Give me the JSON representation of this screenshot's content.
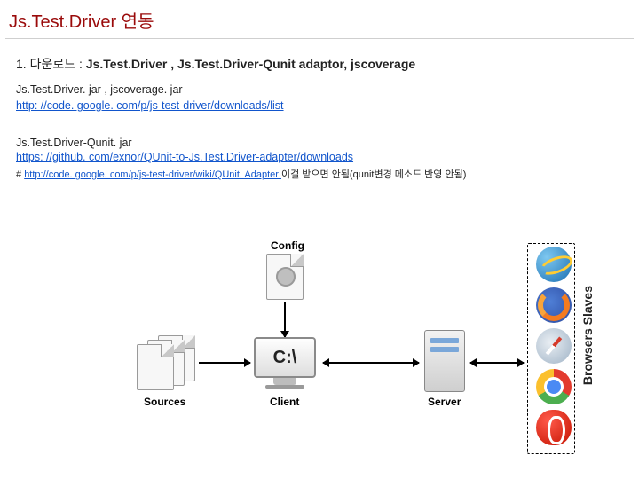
{
  "title": "Js.Test.Driver 연동",
  "step1": {
    "prefix": "1.  다운로드 : ",
    "bold": "Js.Test.Driver ,  Js.Test.Driver-Qunit adaptor,   jscoverage"
  },
  "filesLine": "Js.Test.Driver. jar , jscoverage. jar",
  "link1": "http: //code. google. com/p/js-test-driver/downloads/list",
  "jar2": "Js.Test.Driver-Qunit. jar",
  "link2": " https: //github. com/exnor/QUnit-to-Js.Test.Driver-adapter/downloads ",
  "noteHash": "# ",
  "noteLink": " http://code. google. com/p/js-test-driver/wiki/QUnit. Adapter ",
  "noteTail": " 이걸 받으면 안됨(qunit변경 메소드 반영 안됨)",
  "diagram": {
    "config": "Config",
    "sources": "Sources",
    "client": "Client",
    "server": "Server",
    "browsers": "Browsers Slaves",
    "clientGlyph": "C:\\"
  }
}
